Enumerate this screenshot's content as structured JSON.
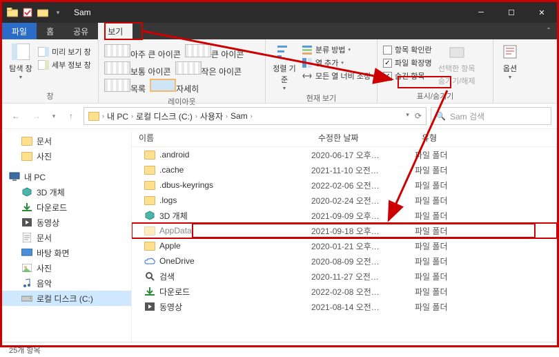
{
  "titlebar": {
    "title": "Sam"
  },
  "tabs": {
    "file": "파일",
    "home": "홈",
    "share": "공유",
    "view": "보기"
  },
  "ribbon": {
    "panes": {
      "nav_label": "탐색 창",
      "preview": "미리 보기 창",
      "details": "세부 정보 창",
      "group_label": "창"
    },
    "layout": {
      "big_icons": "아주 큰 아이콘",
      "large_icons": "큰 아이콘",
      "normal_icons": "보통 아이콘",
      "small_icons": "작은 아이콘",
      "list": "목록",
      "details": "자세히",
      "group_label": "레이아웃"
    },
    "currentview": {
      "sort": "정렬 기준",
      "groupby": "분류 방법",
      "addcol": "열 추가",
      "sizecols": "모든 열 너비 조정",
      "group_label": "현재 보기"
    },
    "showhide": {
      "checkboxes": "항목 확인란",
      "extensions": "파일 확장명",
      "hidden": "숨긴 항목",
      "hidebtn_l1": "선택한 항목",
      "hidebtn_l2": "숨기기/해제",
      "group_label": "표시/숨기기"
    },
    "options": "옵션"
  },
  "nav": {
    "crumbs": [
      "내 PC",
      "로컬 디스크 (C:)",
      "사용자",
      "Sam"
    ],
    "search_placeholder": "Sam 검색"
  },
  "tree": {
    "items": [
      {
        "label": "문서",
        "icon": "folder",
        "indent": 1
      },
      {
        "label": "사진",
        "icon": "folder",
        "indent": 1
      },
      {
        "label": "내 PC",
        "icon": "pc",
        "indent": 0,
        "spaced": true
      },
      {
        "label": "3D 개체",
        "icon": "3d",
        "indent": 1
      },
      {
        "label": "다운로드",
        "icon": "download",
        "indent": 1
      },
      {
        "label": "동영상",
        "icon": "video",
        "indent": 1
      },
      {
        "label": "문서",
        "icon": "docs",
        "indent": 1
      },
      {
        "label": "바탕 화면",
        "icon": "desktop",
        "indent": 1
      },
      {
        "label": "사진",
        "icon": "pics",
        "indent": 1
      },
      {
        "label": "음악",
        "icon": "music",
        "indent": 1
      },
      {
        "label": "로컬 디스크 (C:)",
        "icon": "drive",
        "indent": 1,
        "selected": true
      }
    ]
  },
  "columns": {
    "name": "이름",
    "modified": "수정한 날짜",
    "type": "유형"
  },
  "files": [
    {
      "name": ".android",
      "date": "2020-06-17 오후…",
      "type": "파일 폴더",
      "hidden": false
    },
    {
      "name": ".cache",
      "date": "2021-11-10 오전…",
      "type": "파일 폴더",
      "hidden": false
    },
    {
      "name": ".dbus-keyrings",
      "date": "2022-02-06 오전…",
      "type": "파일 폴더",
      "hidden": false
    },
    {
      "name": ".logs",
      "date": "2020-02-24 오전…",
      "type": "파일 폴더",
      "hidden": false
    },
    {
      "name": "3D 개체",
      "date": "2021-09-09 오후…",
      "type": "파일 폴더",
      "hidden": false,
      "icon3d": true
    },
    {
      "name": "AppData",
      "date": "2021-09-18 오후…",
      "type": "파일 폴더",
      "hidden": true,
      "highlight": true
    },
    {
      "name": "Apple",
      "date": "2020-01-21 오후…",
      "type": "파일 폴더",
      "hidden": false
    },
    {
      "name": "OneDrive",
      "date": "2020-08-09 오전…",
      "type": "파일 폴더",
      "hidden": false,
      "cloud": true
    },
    {
      "name": "검색",
      "date": "2020-11-27 오전…",
      "type": "파일 폴더",
      "hidden": false,
      "search": true
    },
    {
      "name": "다운로드",
      "date": "2022-02-08 오전…",
      "type": "파일 폴더",
      "hidden": false,
      "dl": true
    },
    {
      "name": "동영상",
      "date": "2021-08-14 오전…",
      "type": "파일 폴더",
      "hidden": false,
      "vid": true
    }
  ],
  "status": {
    "count": "25개 항목"
  }
}
